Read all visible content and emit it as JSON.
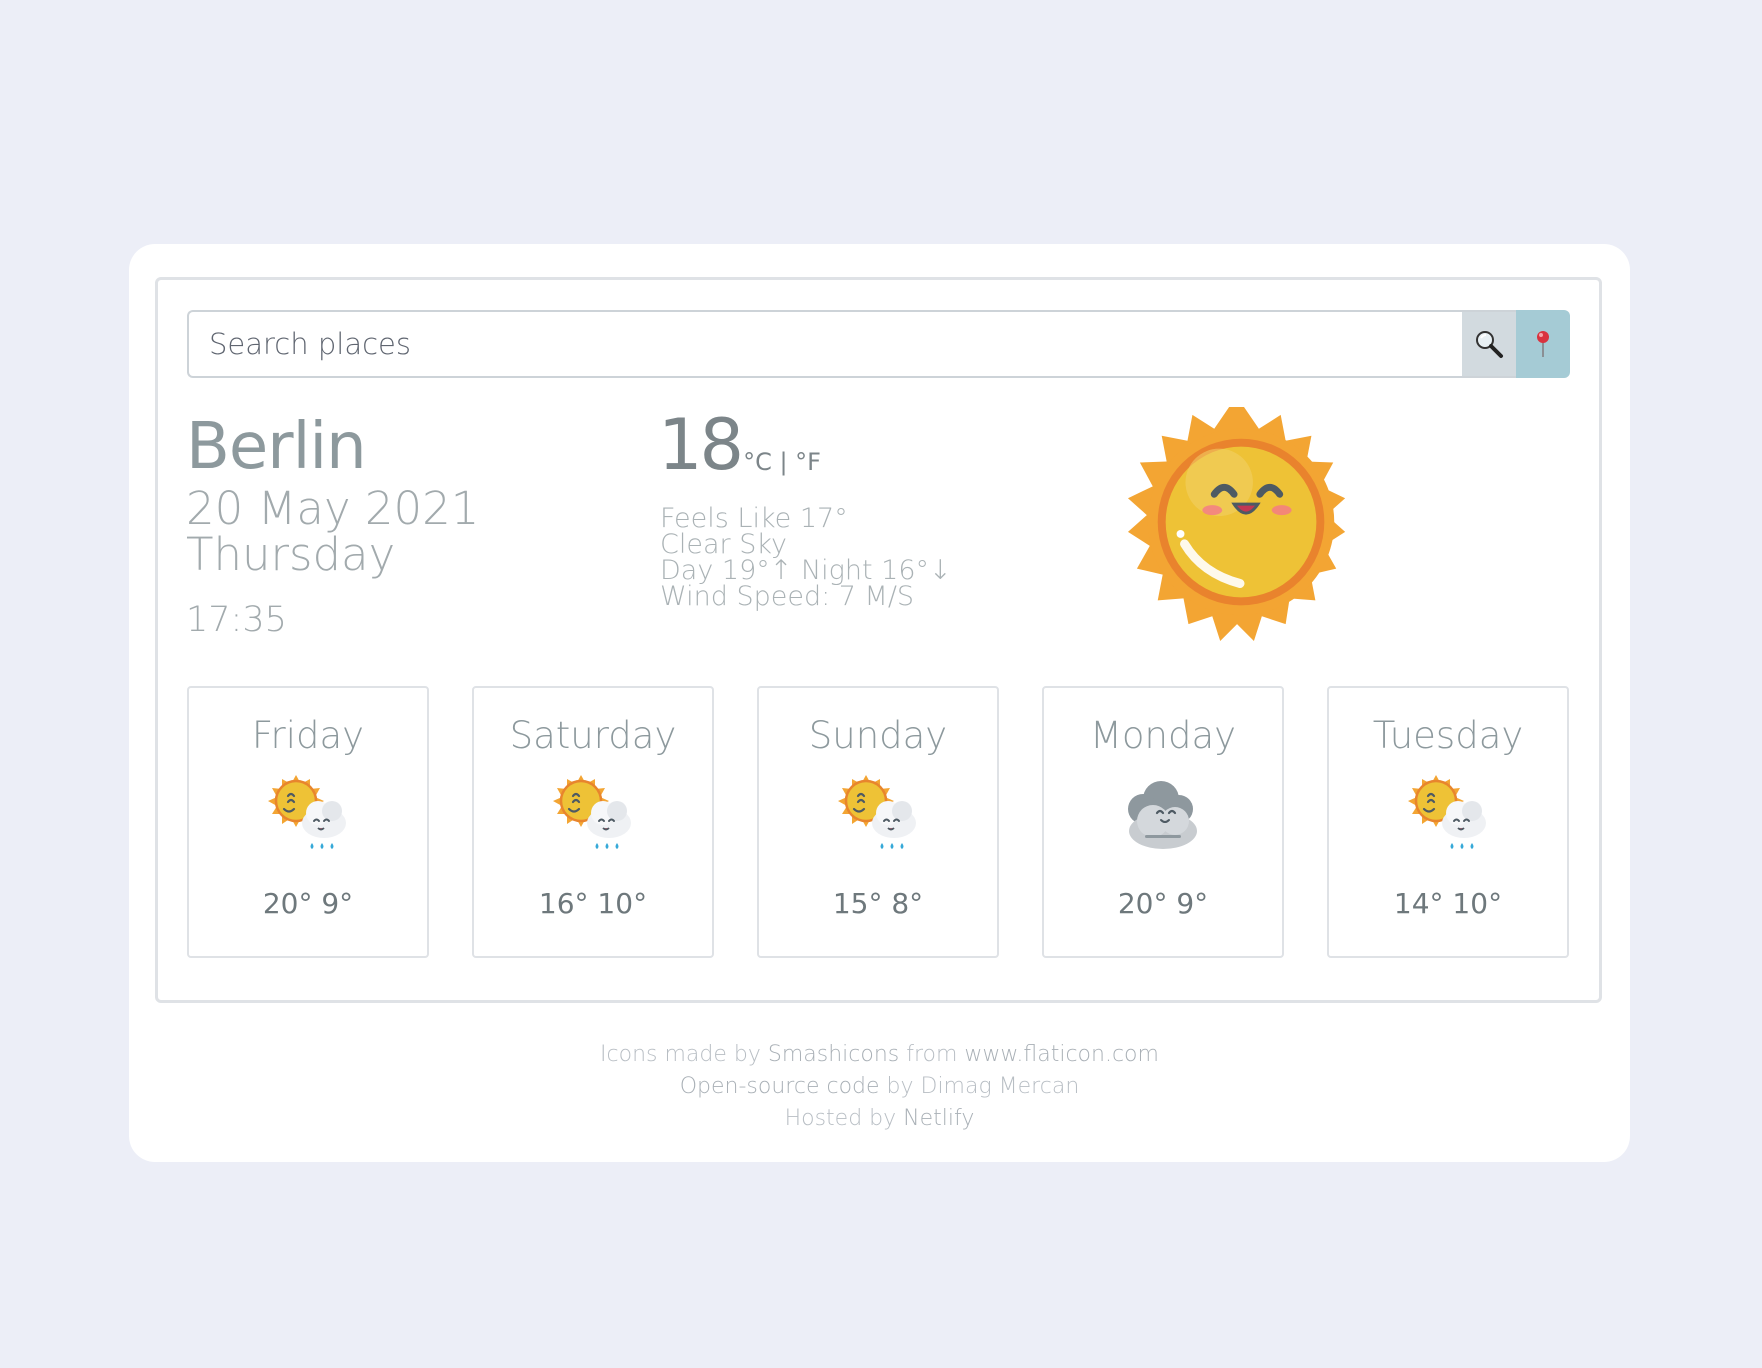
{
  "search": {
    "placeholder": "Search places",
    "search_icon": "magnifier-icon",
    "location_icon": "pin-icon",
    "location_color": "#a5cbd5"
  },
  "current": {
    "city": "Berlin",
    "date": "20 May 2021",
    "weekday": "Thursday",
    "time": "17:35",
    "temperature": "18",
    "units": "°C | °F",
    "feels_like": "Feels Like 17°",
    "description": "Clear Sky",
    "day_night": "Day 19°↑ Night 16°↓",
    "wind": "Wind Speed: 7 M/S",
    "icon": "sun-icon"
  },
  "forecast": [
    {
      "day": "Friday",
      "temps": "20° 9°",
      "icon": "sun-rain-cloud-icon"
    },
    {
      "day": "Saturday",
      "temps": "16° 10°",
      "icon": "sun-rain-cloud-icon"
    },
    {
      "day": "Sunday",
      "temps": "15° 8°",
      "icon": "sun-rain-cloud-icon"
    },
    {
      "day": "Monday",
      "temps": "20° 9°",
      "icon": "cloudy-icon"
    },
    {
      "day": "Tuesday",
      "temps": "14° 10°",
      "icon": "sun-rain-cloud-icon"
    }
  ],
  "footer": {
    "line1_prefix": "Icons made by ",
    "line1_author": "Smashicons",
    "line1_mid": " from ",
    "line1_site": "www.flaticon.com",
    "line2_prefix": "Open-source code",
    "line2_mid": " by Dimag Mercan",
    "line3_prefix": "Hosted by ",
    "line3_host": "Netlify"
  }
}
